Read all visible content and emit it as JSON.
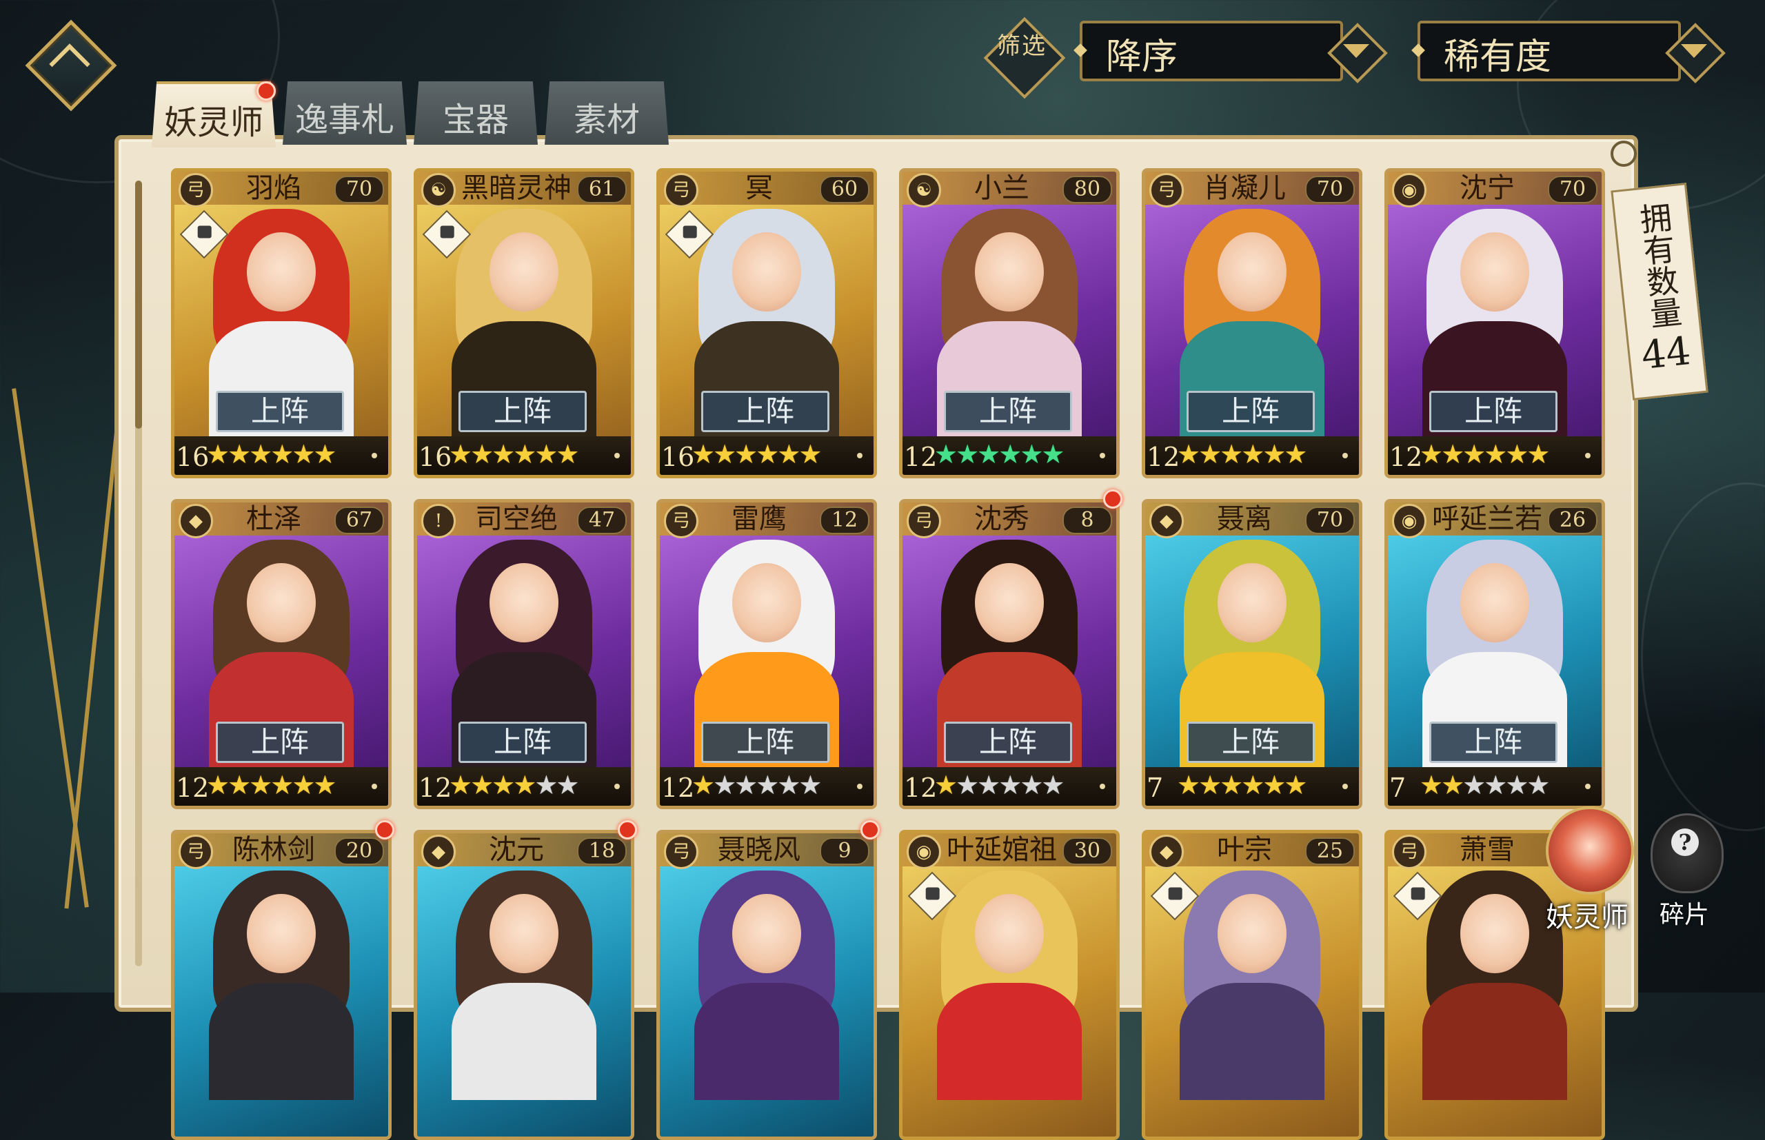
{
  "filter": {
    "label": "筛选",
    "order": "降序",
    "sort_by": "稀有度"
  },
  "tabs": [
    {
      "label": "妖灵师",
      "active": true,
      "badge": true
    },
    {
      "label": "逸事札",
      "active": false,
      "badge": false
    },
    {
      "label": "宝器",
      "active": false,
      "badge": false
    },
    {
      "label": "素材",
      "active": false,
      "badge": false
    }
  ],
  "owned": {
    "label": "拥有数量",
    "count": "44"
  },
  "cards": [
    {
      "name": "羽焰",
      "level": "70",
      "count": "16",
      "stars": 6,
      "star_color": "gold",
      "frame": "gold",
      "locked": true,
      "button": "上阵",
      "badge": false
    },
    {
      "name": "黑暗灵神",
      "level": "61",
      "count": "16",
      "stars": 6,
      "star_color": "gold",
      "frame": "gold",
      "locked": true,
      "button": "上阵",
      "badge": false
    },
    {
      "name": "冥",
      "level": "60",
      "count": "16",
      "stars": 6,
      "star_color": "gold",
      "frame": "gold",
      "locked": true,
      "button": "上阵",
      "badge": false
    },
    {
      "name": "小兰",
      "level": "80",
      "count": "12",
      "stars": 6,
      "star_color": "green",
      "frame": "purple",
      "locked": false,
      "button": "上阵",
      "badge": false
    },
    {
      "name": "肖凝儿",
      "level": "70",
      "count": "12",
      "stars": 6,
      "star_color": "gold",
      "frame": "purple",
      "locked": false,
      "button": "上阵",
      "badge": false
    },
    {
      "name": "沈宁",
      "level": "70",
      "count": "12",
      "stars": 6,
      "star_color": "gold",
      "frame": "purple",
      "locked": false,
      "button": "上阵",
      "badge": false
    },
    {
      "name": "杜泽",
      "level": "67",
      "count": "12",
      "stars": 6,
      "star_color": "gold",
      "frame": "purple",
      "locked": false,
      "button": "上阵",
      "badge": false
    },
    {
      "name": "司空绝",
      "level": "47",
      "count": "12",
      "stars": 4,
      "star_color": "gold",
      "frame": "purple",
      "locked": false,
      "button": "上阵",
      "badge": false
    },
    {
      "name": "雷鹰",
      "level": "12",
      "count": "12",
      "stars": 1,
      "star_color": "gold",
      "frame": "purple",
      "locked": false,
      "button": "上阵",
      "badge": false
    },
    {
      "name": "沈秀",
      "level": "8",
      "count": "12",
      "stars": 1,
      "star_color": "gold",
      "frame": "purple",
      "locked": false,
      "button": "上阵",
      "badge": true
    },
    {
      "name": "聂离",
      "level": "70",
      "count": "7",
      "stars": 6,
      "star_color": "gold",
      "frame": "blue",
      "locked": false,
      "button": "上阵",
      "badge": false
    },
    {
      "name": "呼延兰若",
      "level": "26",
      "count": "7",
      "stars": 2,
      "star_color": "gold",
      "frame": "blue",
      "locked": false,
      "button": "上阵",
      "badge": false
    },
    {
      "name": "陈林剑",
      "level": "20",
      "count": "",
      "stars": 0,
      "star_color": "gold",
      "frame": "blue",
      "locked": false,
      "button": "",
      "badge": true
    },
    {
      "name": "沈元",
      "level": "18",
      "count": "",
      "stars": 0,
      "star_color": "gold",
      "frame": "blue",
      "locked": false,
      "button": "",
      "badge": true
    },
    {
      "name": "聂晓风",
      "level": "9",
      "count": "",
      "stars": 0,
      "star_color": "gold",
      "frame": "blue",
      "locked": false,
      "button": "",
      "badge": true
    },
    {
      "name": "叶延婠祖",
      "level": "30",
      "count": "",
      "stars": 0,
      "star_color": "gold",
      "frame": "gold",
      "locked": true,
      "button": "",
      "badge": false
    },
    {
      "name": "叶宗",
      "level": "25",
      "count": "",
      "stars": 0,
      "star_color": "gold",
      "frame": "gold",
      "locked": true,
      "button": "",
      "badge": false
    },
    {
      "name": "萧雪",
      "level": "",
      "count": "",
      "stars": 0,
      "star_color": "gold",
      "frame": "gold",
      "locked": true,
      "button": "",
      "badge": false
    }
  ],
  "bottom_buttons": {
    "spirit_master": "妖灵师",
    "fragments": "碎片"
  }
}
